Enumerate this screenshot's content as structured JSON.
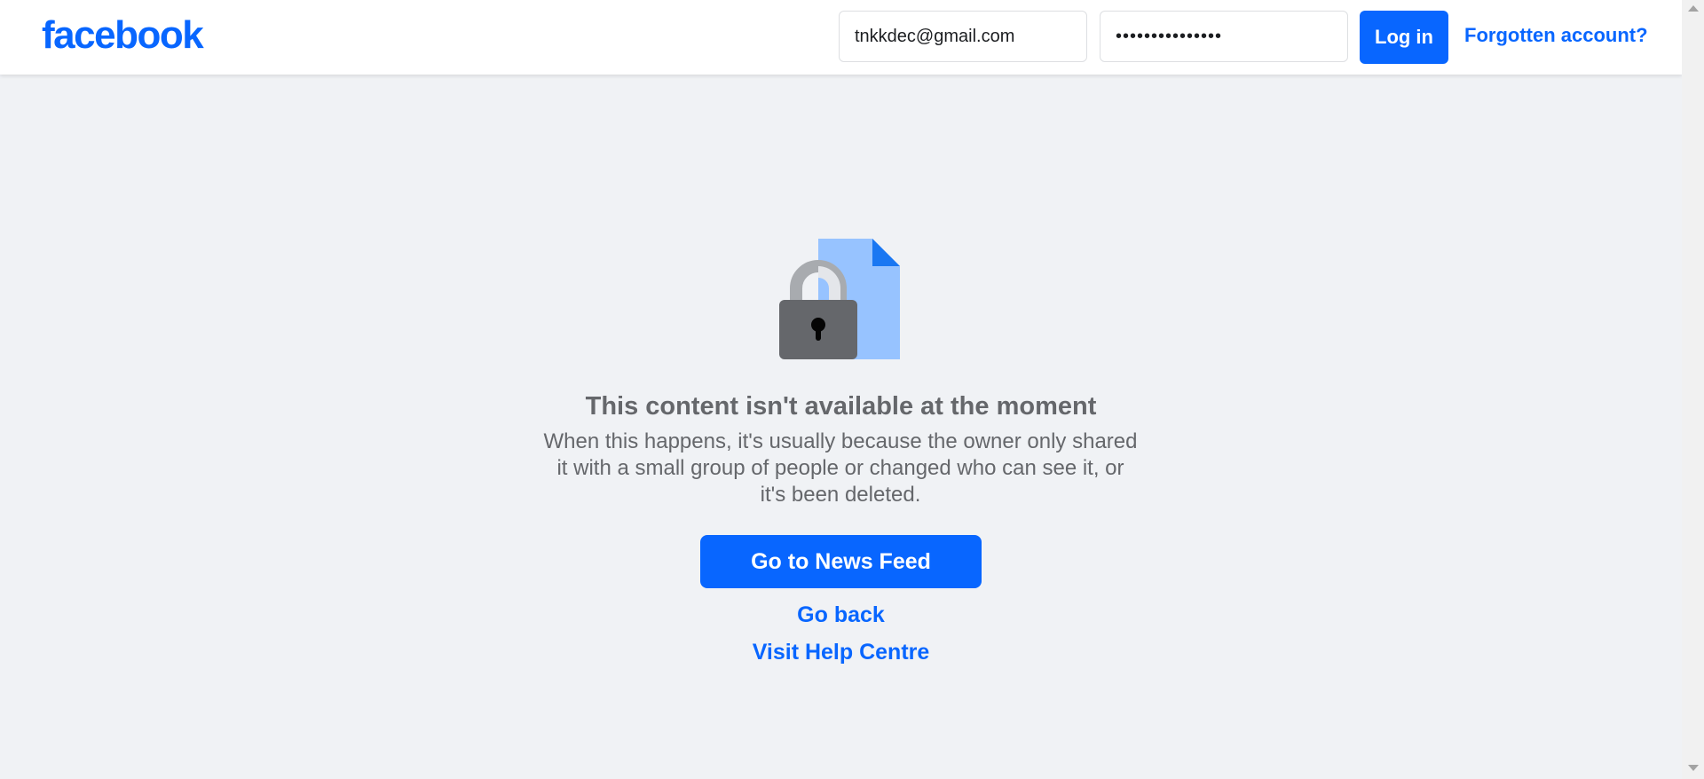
{
  "header": {
    "logo_text": "facebook",
    "email_value": "tnkkdec@gmail.com",
    "password_value": "•••••••••••••••",
    "login_label": "Log in",
    "forgot_label": "Forgotten account?"
  },
  "main": {
    "title": "This content isn't available at the moment",
    "description": "When this happens, it's usually because the owner only shared it with a small group of people or changed who can see it, or it's been deleted.",
    "news_feed_label": "Go to News Feed",
    "go_back_label": "Go back",
    "help_label": "Visit Help Centre",
    "illustration_icon": "locked-document-icon"
  },
  "colors": {
    "brand_blue": "#0866ff",
    "background": "#f0f2f5",
    "secondary_text": "#65676b"
  }
}
